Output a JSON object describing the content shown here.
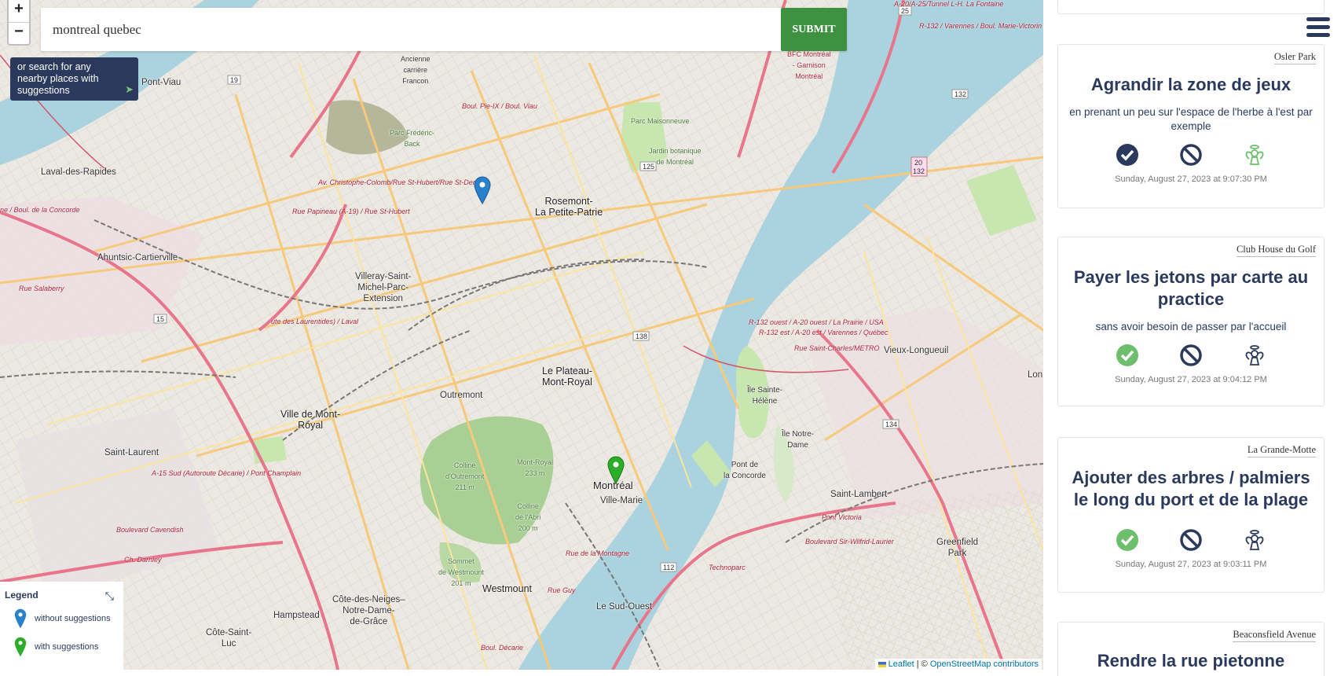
{
  "map": {
    "zoom_in": "+",
    "zoom_out": "−",
    "search": {
      "value": "montreal quebec",
      "submit_label": "SUBMIT"
    },
    "nearby_hint": "or search for any nearby places with suggestions",
    "legend": {
      "title": "Legend",
      "items": [
        {
          "label": "without suggestions",
          "color": "#2a81cb"
        },
        {
          "label": "with suggestions",
          "color": "#2aad27"
        }
      ]
    },
    "attribution": {
      "leaflet": "Leaflet",
      "sep": " | © ",
      "osm": "OpenStreetMap contributors"
    },
    "labels": {
      "pont_viau": "Pont-Viau",
      "laval": "Laval-des-Rapides",
      "ahuntsic": "Ahuntsic-Cartierville",
      "rosemont": "Rosemont-\nLa Petite-Patrie",
      "villeray": "Villeray-Saint-\nMichel-Parc-\nExtension",
      "plateau": "Le Plateau-\nMont-Royal",
      "outremont": "Outremont",
      "mont_royal": "Ville de Mont-\nRoyal",
      "saint_laurent": "Saint-Laurent",
      "montreal": "Montréal",
      "ville_marie": "Ville-Marie",
      "westmount": "Westmount",
      "sud_ouest": "Le Sud-Ouest",
      "cdn": "Côte-des-Neiges–\nNotre-Dame-\nde-Grâce",
      "hampstead": "Hampstead",
      "csl": "Côte-Saint-\nLuc",
      "vieux_longueuil": "Vieux-Longueuil",
      "saint_lambert": "Saint-Lambert",
      "greenfield": "Greenfield\nPark",
      "ile_ste_helene": "Île Sainte-\nHélène",
      "ile_notre_dame": "Île Notre-\nDame",
      "pont_concorde": "Pont de\nla Concorde",
      "parc_maisonneuve": "Parc Maisonneuve",
      "jardin": "Jardin botanique\nde Montréal",
      "carriere": "Ancienne\ncarrière\nFrancon",
      "parc_frederic": "Parc Frédéric-\nBack",
      "colline_outremont": "Colline\nd'Outremont\n211 m",
      "mont_royal_peak": "Mont-Royal\n233 m",
      "colline_abri": "Colline\nde l'Abri\n200 m",
      "westmount_summit": "Sommet\nde Westmount\n201 m",
      "bfc": "BFC Montréal\n- Garnison\nMontréal",
      "lon": "Lon",
      "boul_concorde": "ne / Boul. de la Concorde",
      "rue_salaberry": "Rue Salaberry",
      "av_christophe": "Av. Christophe-Colomb/Rue St-Hubert/Rue St-Denis",
      "rue_papineau": "Rue Papineau (A-19) / Rue St-Hubert",
      "laurentides": "ute des Laurentides) / Laval",
      "a15": "A-15 Sud (Autoroute Décarie) / Pont Champlain",
      "cavendish": "Boulevard Cavendish",
      "darnley": "Ch. Darnley",
      "montagne": "Rue de la Montagne",
      "guy": "Rue Guy",
      "decarie": "Boul. Décarie",
      "pie_ix": "Boul. Pie-IX / Boul. Viau",
      "r132": "R-132 ouest / A-20 ouest / La Prairie / USA",
      "r132b": "R-132 est / A-20 est / Varennes / Québec",
      "st_charles": "Rue Saint-Charles/METRO",
      "pont_victoria": "Pont Victoria",
      "sir_wilfrid": "Boulevard Sir-Wilfrid-Laurier",
      "technoparc": "Technoparc",
      "r132c": "R-132 / Varennes / Boul. Marie-Victorin",
      "a20": "A-20/A-25/Tunnel L-H. La Fontaine"
    }
  },
  "sidebar": {
    "cards": [
      {
        "place": "Osler Park",
        "title": "Agrandir la zone de jeux",
        "description": "en prenant un peu sur l'espace de l'herbe à l'est par exemple",
        "timestamp": "Sunday, August 27, 2023 at 9:07:30 PM",
        "state": {
          "check": "dark",
          "ban": "dark",
          "angel": "green"
        }
      },
      {
        "place": "Club House du Golf",
        "title": "Payer les jetons par carte au practice",
        "description": "sans avoir besoin de passer par l'accueil",
        "timestamp": "Sunday, August 27, 2023 at 9:04:12 PM",
        "state": {
          "check": "green",
          "ban": "dark",
          "angel": "dark"
        }
      },
      {
        "place": "La Grande-Motte",
        "title": "Ajouter des arbres / palmiers le long du port et de la plage",
        "description": "",
        "timestamp": "Sunday, August 27, 2023 at 9:03:11 PM",
        "state": {
          "check": "green",
          "ban": "dark",
          "angel": "dark"
        }
      },
      {
        "place": "Beaconsfield Avenue",
        "title": "Rendre la rue pietonne",
        "description": "",
        "timestamp": "",
        "state": {}
      }
    ]
  },
  "colors": {
    "navy": "#2b3a5c",
    "green": "#6dbf6d",
    "submit": "#3f9142",
    "water": "#aad3df",
    "park": "#c8e6b0"
  }
}
